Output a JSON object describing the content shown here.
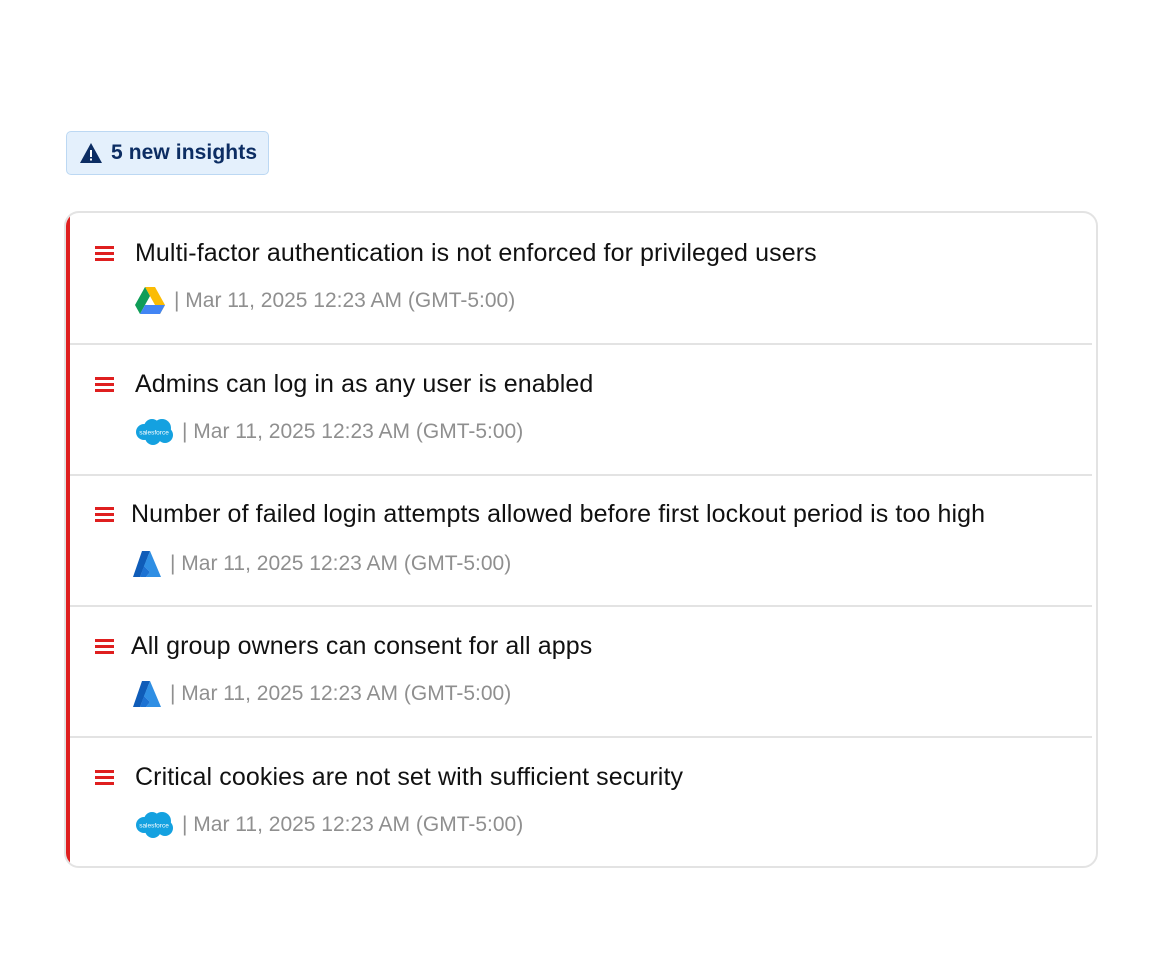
{
  "summary": {
    "badge_label": "5 new insights",
    "badge_icon": "warning-icon",
    "badge_bg": "#e4f0fc",
    "badge_text_color": "#0c2d63"
  },
  "severity_color": "#df1f1f",
  "insights": [
    {
      "title": "Multi-factor authentication is not enforced for privileged users",
      "app_icon": "google-drive-icon",
      "meta": "| Mar 11, 2025 12:23 AM (GMT-5:00)"
    },
    {
      "title": "Admins can log in as any user is enabled",
      "app_icon": "salesforce-icon",
      "app_icon_text": "salesforce",
      "meta": "| Mar 11, 2025 12:23 AM (GMT-5:00)"
    },
    {
      "title": "Number of failed login attempts allowed before first lockout period is too high",
      "app_icon": "azure-icon",
      "meta": "| Mar 11, 2025 12:23 AM (GMT-5:00)"
    },
    {
      "title": "All group owners can consent for all apps",
      "app_icon": "azure-icon",
      "meta": "| Mar 11, 2025 12:23 AM (GMT-5:00)"
    },
    {
      "title": "Critical cookies are not set with sufficient security",
      "app_icon": "salesforce-icon",
      "app_icon_text": "salesforce",
      "meta": "| Mar 11, 2025 12:23 AM (GMT-5:00)"
    }
  ]
}
